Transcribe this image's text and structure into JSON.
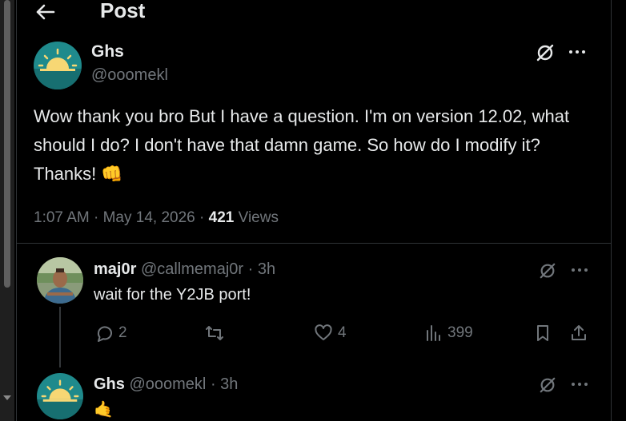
{
  "header": {
    "title": "Post"
  },
  "post": {
    "display_name": "Ghs",
    "handle": "@ooomekl",
    "text": "Wow thank you bro But I have a question. I'm on version 12.02, what should I do? I don't have that damn game. So how do I modify it? Thanks! 👊",
    "time": "1:07 AM",
    "date": "May 14, 2026",
    "views_count": "421",
    "views_label": "Views"
  },
  "replies": [
    {
      "display_name": "maj0r",
      "handle": "@callmemaj0r",
      "age": "3h",
      "text": "wait for the Y2JB port!",
      "replies_count": "2",
      "reposts_count": "",
      "likes_count": "4",
      "views_count": "399"
    },
    {
      "display_name": "Ghs",
      "handle": "@ooomekl",
      "age": "3h",
      "text": "🤙"
    }
  ],
  "colors": {
    "background": "#000000",
    "text": "#e7e9ea",
    "muted": "#71767b",
    "border": "#2f3336",
    "avatar_teal": "#1f8a8c",
    "avatar_sun": "#f7d774"
  }
}
